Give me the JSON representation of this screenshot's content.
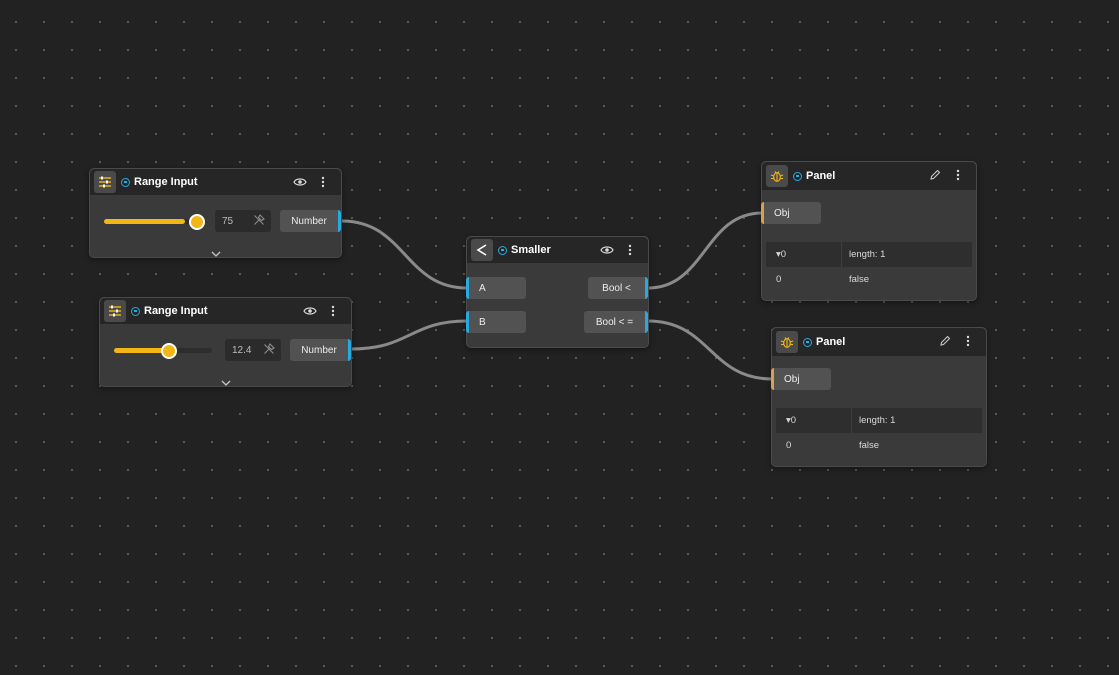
{
  "nodes": {
    "range1": {
      "title": "Range Input",
      "value_text": "75",
      "value_fraction": 0.73,
      "output_label": "Number"
    },
    "range2": {
      "title": "Range Input",
      "value_text": "12.4",
      "value_fraction": 0.55,
      "output_label": "Number"
    },
    "smaller": {
      "title": "Smaller",
      "input_a": "A",
      "input_b": "B",
      "output_lt": "Bool <",
      "output_le": "Bool < ="
    },
    "panel1": {
      "title": "Panel",
      "input_label": "Obj",
      "row_index_header": "▾0",
      "row_value_header": "length: 1",
      "row_index": "0",
      "row_value": "false"
    },
    "panel2": {
      "title": "Panel",
      "input_label": "Obj",
      "row_index_header": "▾0",
      "row_value_header": "length: 1",
      "row_index": "0",
      "row_value": "false"
    }
  },
  "colors": {
    "accent_port": "#29a9e0",
    "slider": "#f3b617",
    "obj_port": "#d9a050",
    "wire": "#8a8a8a"
  },
  "icons": [
    "sliders-icon",
    "less-than-icon",
    "bug-icon",
    "eye-icon",
    "menu-icon",
    "edit-icon",
    "pin-icon",
    "chevron-down-icon"
  ]
}
